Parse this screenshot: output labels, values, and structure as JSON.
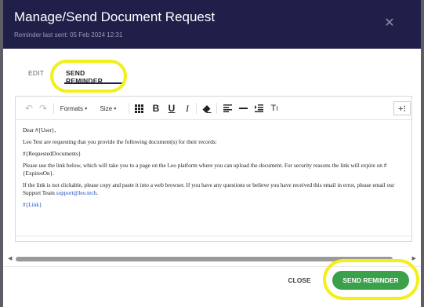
{
  "modal": {
    "title": "Manage/Send Document Request",
    "subtitle": "Reminder last sent: 05 Feb 2024 12:31"
  },
  "tabs": [
    {
      "label": "EDIT",
      "active": false
    },
    {
      "label": "SEND REMINDER",
      "active": true
    }
  ],
  "toolbar": {
    "formats_label": "Formats",
    "size_label": "Size",
    "buttons": [
      "undo-icon",
      "redo-icon",
      "table-icon",
      "bold-icon",
      "underline-icon",
      "italic-icon",
      "eraser-icon",
      "align-left-icon",
      "horizontal-rule-icon",
      "indent-icon",
      "clear-format-icon",
      "more-icon"
    ]
  },
  "content": {
    "greeting": "Dear #{User},",
    "line1": "Leo Test are requesting that you provide the following document(s) for their records:",
    "line2": "#{RequestedDocuments}",
    "line3": "Please use the link below, which will take you to a page on the Leo platform where you can upload the document. For security reasons the link will expire on #{ExpiresOn}.",
    "line4_pre": "If the link is not clickable, please copy and paste it into a web browser. If you have any questions or believe you have received this email in error, please email our Support Team ",
    "support_email": "support@leo.tech",
    "line4_post": ".",
    "link_token": "#{Link}"
  },
  "footer": {
    "close_label": "CLOSE",
    "send_label": "SEND REMINDER"
  },
  "colors": {
    "header_bg": "#1f1f4a",
    "send_button": "#3aa04a",
    "highlight": "#f2ef1d",
    "link": "#1a4fbf"
  },
  "scroll": {
    "position": 0.0,
    "visible_fraction": 0.96
  }
}
